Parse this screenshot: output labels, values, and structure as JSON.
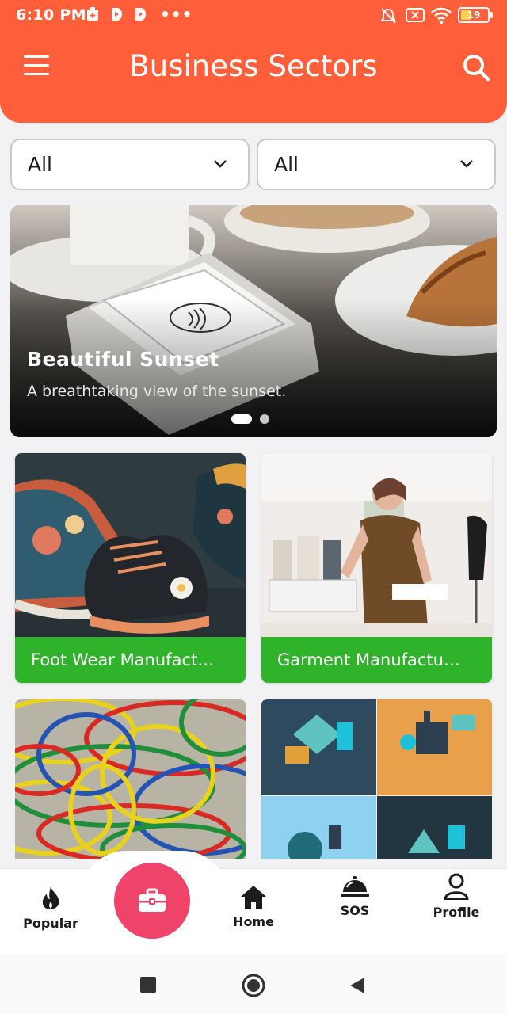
{
  "status_bar": {
    "time": "6:10 PM",
    "more": "•••",
    "battery": "19"
  },
  "header": {
    "title": "Business Sectors"
  },
  "filters": [
    {
      "value": "All"
    },
    {
      "value": "All"
    }
  ],
  "carousel": {
    "title": "Beautiful Sunset",
    "subtitle": "A breathtaking view of the sunset.",
    "slide_count": 2,
    "active_slide": 1
  },
  "sectors": [
    {
      "label": "Foot Wear Manufact…"
    },
    {
      "label": "Garment Manufactu…"
    }
  ],
  "bottom_nav": {
    "popular": "Popular",
    "home": "Home",
    "sos": "SOS",
    "profile": "Profile"
  },
  "colors": {
    "header": "#ff5e3a",
    "card_label": "#2fb32b",
    "fab": "#f0436a"
  }
}
